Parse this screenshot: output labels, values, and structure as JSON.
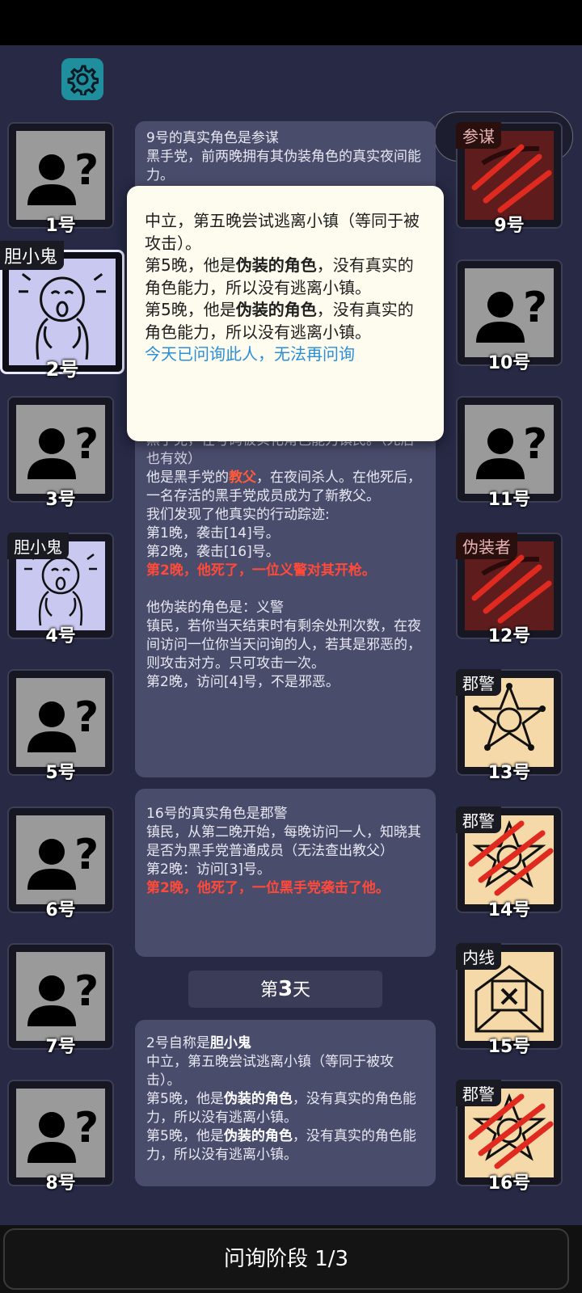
{
  "players_left": [
    {
      "label": "1号",
      "role": "",
      "state": "unknown"
    },
    {
      "label": "2号",
      "role": "胆小鬼",
      "state": "coward"
    },
    {
      "label": "3号",
      "role": "",
      "state": "unknown"
    },
    {
      "label": "4号",
      "role": "胆小鬼",
      "state": "coward"
    },
    {
      "label": "5号",
      "role": "",
      "state": "unknown"
    },
    {
      "label": "6号",
      "role": "",
      "state": "unknown"
    },
    {
      "label": "7号",
      "role": "",
      "state": "unknown"
    },
    {
      "label": "8号",
      "role": "",
      "state": "unknown"
    }
  ],
  "players_right": [
    {
      "label": "9号",
      "role": "参谋",
      "state": "dead-red"
    },
    {
      "label": "10号",
      "role": "",
      "state": "unknown"
    },
    {
      "label": "11号",
      "role": "",
      "state": "unknown"
    },
    {
      "label": "12号",
      "role": "伪装者",
      "state": "dead-red"
    },
    {
      "label": "13号",
      "role": "郡警",
      "state": "sheriff"
    },
    {
      "label": "14号",
      "role": "郡警",
      "state": "sheriff-dead"
    },
    {
      "label": "15号",
      "role": "内线",
      "state": "informant"
    },
    {
      "label": "16号",
      "role": "郡警",
      "state": "sheriff-dead"
    }
  ],
  "msg1": {
    "line1": "9号的真实角色是参谋",
    "line2": "黑手党，前两晚拥有其伪装角色的真实夜间能力。"
  },
  "msg2": {
    "partial": "黑手党，在号码被实化角色能力镇民。（死后也有效）",
    "a1": "他是黑手党的",
    "a2": "教父",
    "a3": "，在夜间杀人。在他死后，一名存活的黑手党成员成为了新教父。",
    "b": "我们发现了他真实的行动踪迹:",
    "c": "第1晚，袭击[14]号。",
    "d": "第2晚，袭击[16]号。",
    "e": "第2晚，他死了，一位义警对其开枪。",
    "f": "他伪装的角色是：义警",
    "g": "镇民，若你当天结束时有剩余处刑次数，在夜间访问一位你当天问询的人，若其是邪恶的，则攻击对方。只可攻击一次。",
    "h": "第2晚，访问[4]号，不是邪恶。"
  },
  "msg3": {
    "a": "16号的真实角色是郡警",
    "b": "镇民，从第二晚开始，每晚访问一人，知晓其是否为黑手党普通成员（无法查出教父）",
    "c": "第2晚：访问[3]号。",
    "d": "第2晚，他死了，一位黑手党袭击了他。"
  },
  "day": {
    "prefix": "第",
    "num": "3",
    "suffix": "天"
  },
  "msg4": {
    "a1": "2号自称是",
    "a2": "胆小鬼",
    "b": "中立，第五晚尝试逃离小镇（等同于被攻击）。",
    "c1": "第5晚，他是",
    "c2": "伪装的角色",
    "c3": "，没有真实的角色能力，所以没有逃离小镇。",
    "d1": "第5晚，他是",
    "d2": "伪装的角色",
    "d3": "，没有真实的角色能力，所以没有逃离小镇。"
  },
  "popup": {
    "a": "中立，第五晚尝试逃离小镇（等同于被攻击）。",
    "b1": "第5晚，他是",
    "b2": "伪装的角色",
    "b3": "，没有真实的角色能力，所以没有逃离小镇。",
    "c1": "第5晚，他是",
    "c2": "伪装的角色",
    "c3": "，没有真实的角色能力，所以没有逃离小镇。",
    "link": "今天已问询此人，无法再问询"
  },
  "footer": {
    "phase": "问询阶段 1/3"
  },
  "colors": {
    "bg": "#272945",
    "accent_red": "#ff4a3a",
    "link": "#2a8ed8"
  }
}
